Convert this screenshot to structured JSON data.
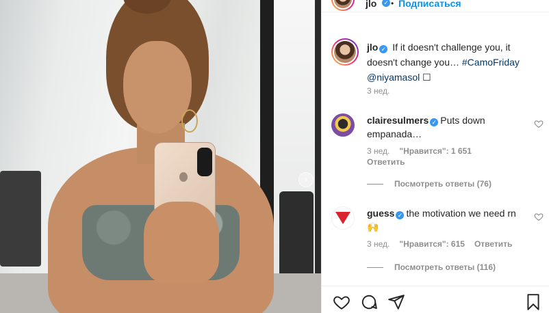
{
  "header": {
    "username": "jlo",
    "separator": "•",
    "follow_label": "Подписаться"
  },
  "caption": {
    "username": "jlo",
    "text_part1": "If it doesn't challenge you, it doesn't change you…",
    "hashtag": "#CamoFriday",
    "mention": "@niyamasol",
    "trailing_glyph": "☐",
    "time": "3 нед."
  },
  "comments": [
    {
      "username": "clairesulmers",
      "text": "Puts down empanada…",
      "time": "3 нед.",
      "likes_label": "\"Нравится\": 1 651",
      "reply_label": "Ответить",
      "view_replies": "Посмотреть ответы (76)"
    },
    {
      "username": "guess",
      "text": "the motivation we need rn",
      "emoji": "🙌",
      "time": "3 нед.",
      "likes_label": "\"Нравится\": 615",
      "reply_label": "Ответить",
      "view_replies": "Посмотреть ответы (116)"
    }
  ],
  "icons": {
    "like": "heart-icon",
    "comment": "comment-icon",
    "share": "paper-plane-icon",
    "save": "bookmark-icon",
    "verified": "verified-badge-icon",
    "next": "chevron-right-icon"
  },
  "colors": {
    "follow_blue": "#0095f6",
    "link_blue": "#00376b",
    "verified_blue": "#3897f0",
    "muted": "#8e8e8e"
  }
}
